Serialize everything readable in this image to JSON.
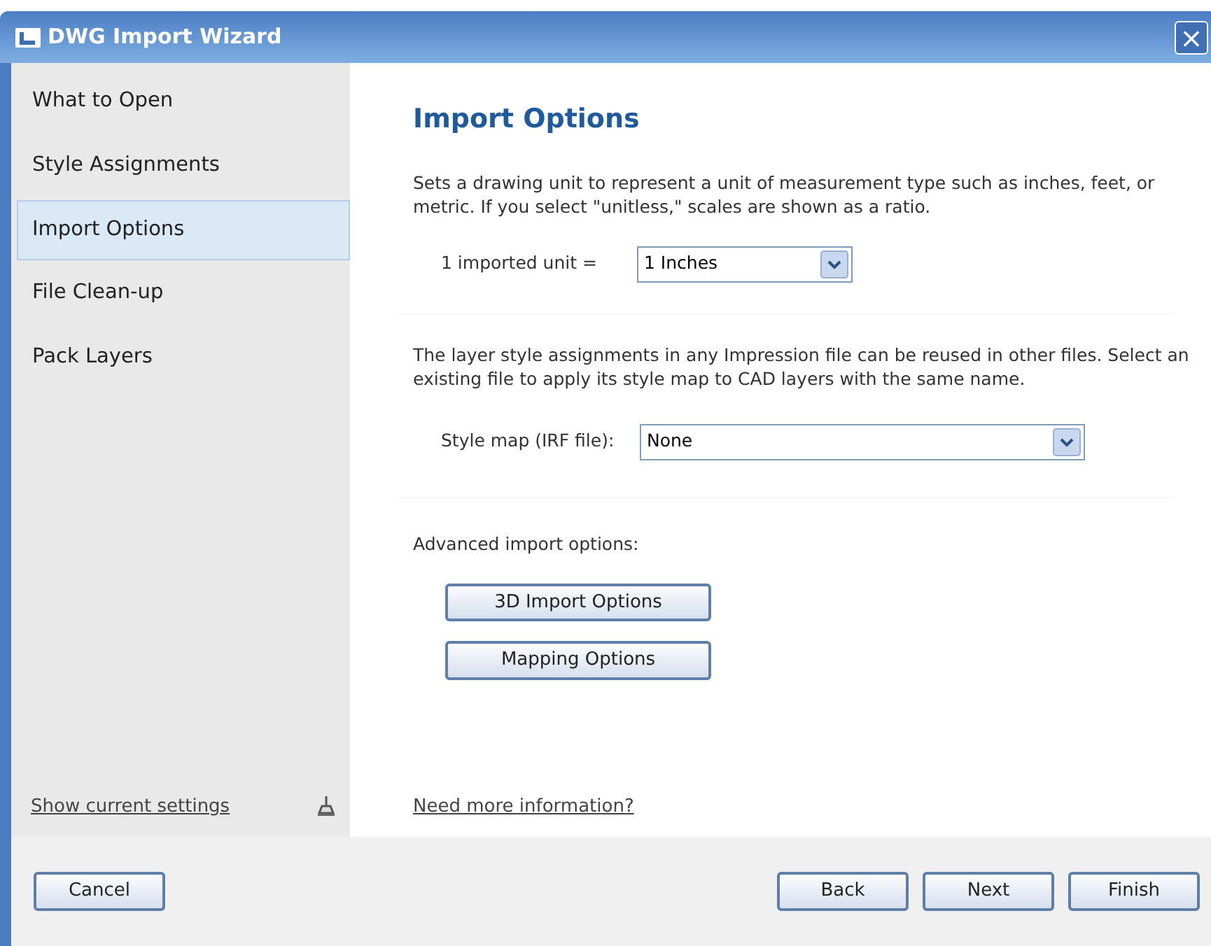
{
  "window": {
    "title": "DWG Import Wizard",
    "close": "×"
  },
  "sidebar": {
    "items": [
      {
        "label": "What to Open",
        "selected": false
      },
      {
        "label": "Style Assignments",
        "selected": false
      },
      {
        "label": "Import Options",
        "selected": true
      },
      {
        "label": "File Clean-up",
        "selected": false
      },
      {
        "label": "Pack Layers",
        "selected": false
      }
    ],
    "footer_link": "Show current settings"
  },
  "content": {
    "heading": "Import Options",
    "unit_description": "Sets a drawing unit to represent a unit of measurement type such as inches, feet, or metric. If you select \"unitless,\" scales are shown as a ratio.",
    "unit_label": "1 imported unit =",
    "unit_value": "1 Inches",
    "style_description": "The layer style assignments in any Impression file can be reused in other files. Select an existing file to apply its style map to CAD layers with the same name.",
    "style_label": "Style map (IRF file):",
    "style_value": "None",
    "advanced_label": "Advanced import options:",
    "advanced_buttons": [
      "3D Import Options",
      "Mapping Options"
    ],
    "help_link": "Need more information?"
  },
  "footer": {
    "left_buttons": [
      "Cancel"
    ],
    "right_buttons": [
      "Back",
      "Next",
      "Finish"
    ]
  }
}
